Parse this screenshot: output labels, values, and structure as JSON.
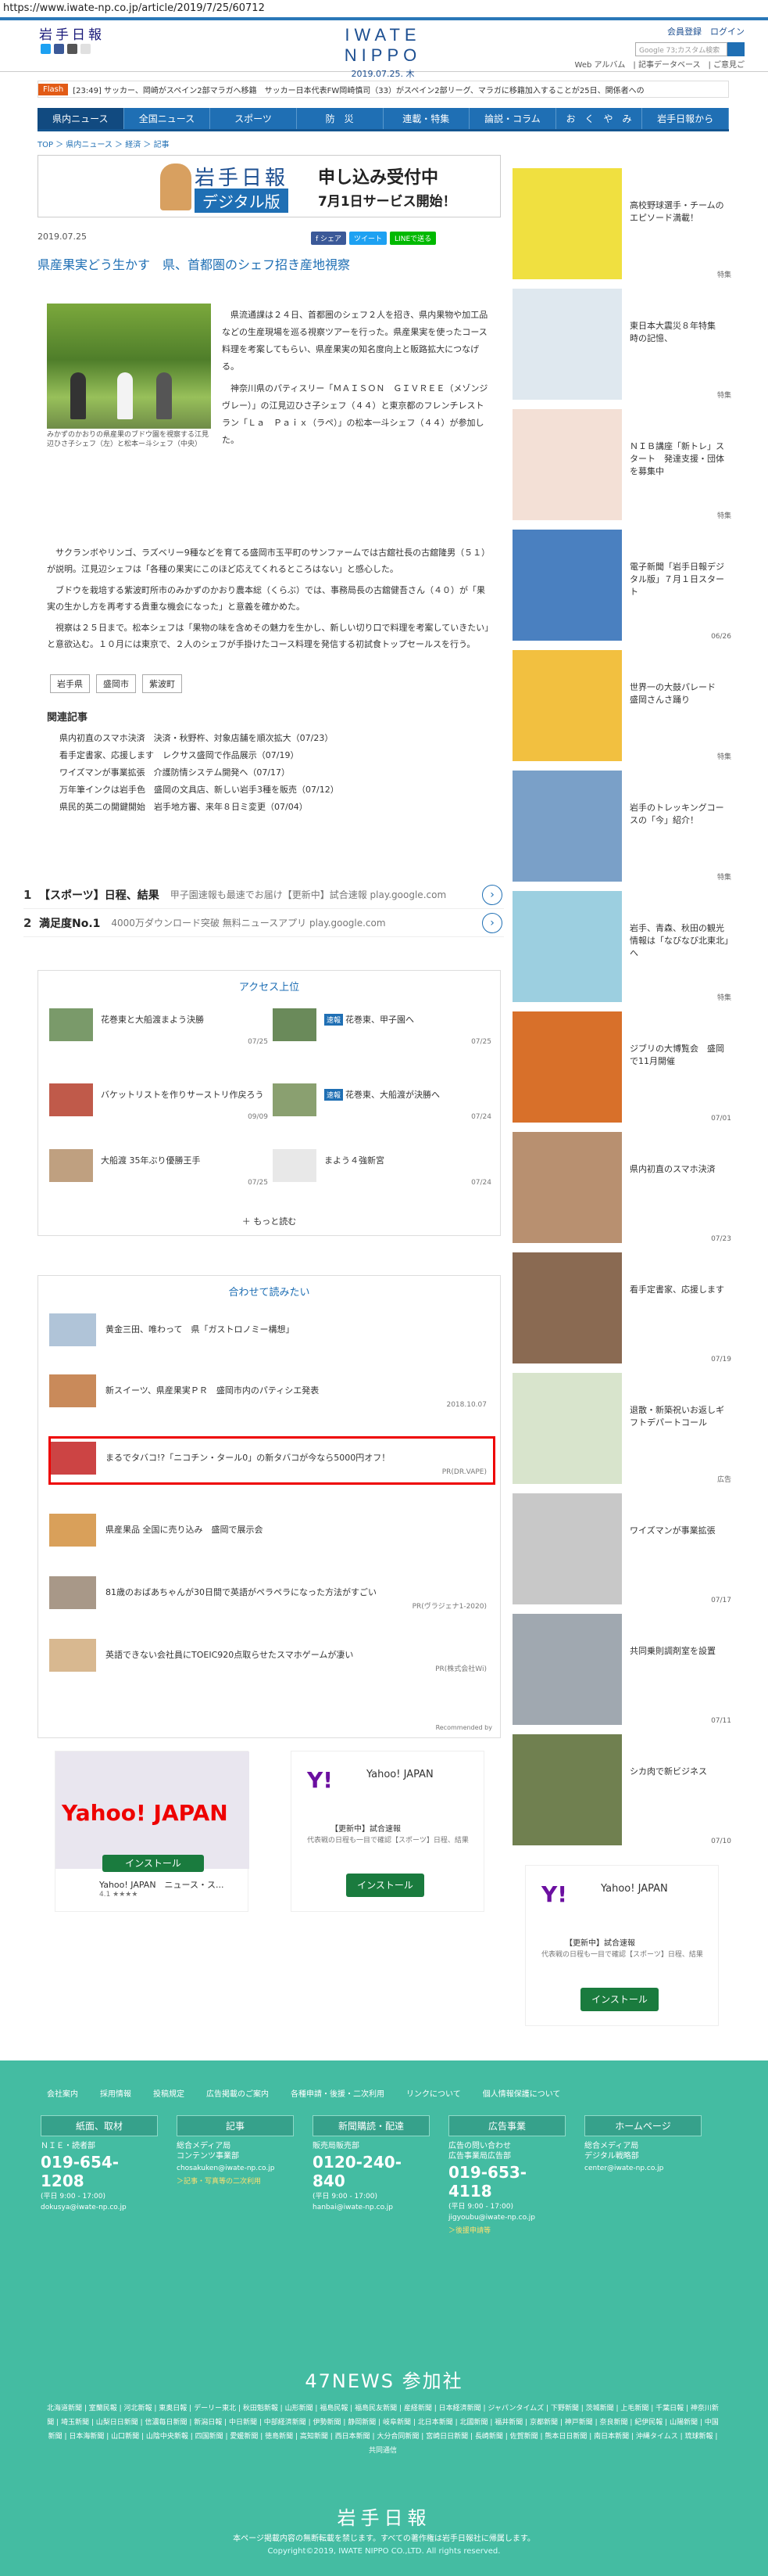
{
  "url": "https://www.iwate-np.co.jp/article/2019/7/25/60712",
  "header": {
    "logo_left": "岩手日報",
    "logo_center": "IWATE NIPPO",
    "date": "2019.07.25. 木",
    "account_links": "会員登録　ログイン",
    "search_placeholder": "Google 73;カスタム検索",
    "sublinks": "Web アルバム　| 記事データベース　| ご意見ご"
  },
  "flash": {
    "tag": "Flash",
    "text": "[23:49] サッカー、岡崎がスペイン2部マラガへ移籍　サッカー日本代表FW岡崎慎司（33）がスペイン2部リーグ、マラガに移籍加入することが25日、関係者への"
  },
  "nav": [
    "県内ニュース",
    "全国ニュース",
    "スポーツ",
    "防　災",
    "連載・特集",
    "論説・コラム",
    "お　く　や　み",
    "岩手日報から"
  ],
  "breadcrumb": "TOP ＞ 県内ニュース ＞ 経済 ＞ 記事",
  "banner": {
    "brand": "岩手日報",
    "digital": "デジタル版",
    "apply": "申し込み受付中",
    "start": "7月1日サービス開始！"
  },
  "article": {
    "date": "2019.07.25",
    "share": [
      "f シェア",
      "ツイート",
      "LINEで送る"
    ],
    "title": "県産果実どう生かす　県、首都圏のシェフ招き産地視察",
    "caption": "みかずのかおりの県産果のブドウ園を視察する江見辺ひさ子シェフ（左）と松本ー斗シェフ（中央）",
    "para1": "　県流通課は２４日、首都圏のシェフ２人を招き、県内果物や加工品などの生産現場を巡る視察ツアーを行った。県産果実を使ったコース料理を考案してもらい、県産果実の知名度向上と販路拡大につなげる。",
    "para2": "　神奈川県のパティスリー「ＭＡＩＳＯＮ　ＧＩＶＲＥＥ（メゾンジヴレー）」の江見辺ひさ子シェフ（４４）と東京都のフレンチレストラン「Ｌａ　Ｐａｉｘ（ラペ）」の松本一斗シェフ（４４）が参加した。",
    "para3": "　サクランボやリンゴ、ラズベリー9種などを育てる盛岡市玉平町のサンファームでは古舘社長の古舘隆男（５１）が説明。江見辺シェフは「各種の果実にこのほど応えてくれるところはない」と感心した。",
    "para4": "　ブドウを栽培する紫波町所市のみかずのかおり農本総（くらぶ）では、事務局長の古舘健吾さん（４０）が「果実の生かし方を再考する貴重な機会になった」と意義を確かめた。",
    "para5": "　視察は２５日まで。松本シェフは「果物の味を含めその魅力を生かし、新しい切り口で料理を考案していきたい」と意欲込む。１０月には東京で、２人のシェフが手掛けたコース料理を発信する初試食トップセールスを行う。",
    "tags": [
      "岩手県",
      "盛岡市",
      "紫波町"
    ],
    "related_title": "関連記事",
    "related": [
      "県内初直のスマホ決済　決済・秋野杵、対象店舗を順次拡大（07/23）",
      "看手定書家、応援します　レクサス盛岡で作品展示（07/19）",
      "ワイズマンが事業拡張　介護防情システム開発へ（07/17）",
      "万年筆インクは岩手色　盛岡の文具店、新しい岩手3種を販売（07/12）",
      "県民的英二の開鍵開始　岩手地方審、来年８日ミ変更（07/04）"
    ]
  },
  "ads1": [
    {
      "num": "1",
      "title": "【スポーツ】日程、結果",
      "desc": "甲子園速報も最速でお届け【更新中】試合速報 play.google.com"
    },
    {
      "num": "2",
      "title": "満足度No.1",
      "desc": "4000万ダウンロード突破 無料ニュースアプリ play.google.com"
    }
  ],
  "ranking": {
    "title": "アクセス上位",
    "items": [
      {
        "badge": "",
        "text": "花巻東と大船渡まよう決勝",
        "date": "07/25"
      },
      {
        "badge": "速報",
        "text": "花巻東、甲子園へ",
        "date": "07/25"
      },
      {
        "badge": "",
        "text": "バケットリストを作りサーストリ作戻ろう",
        "date": "09/09"
      },
      {
        "badge": "速報",
        "text": "花巻東、大船渡が決勝へ",
        "date": "07/24"
      },
      {
        "badge": "",
        "text": "大船渡 35年ぶり優勝王手",
        "date": "07/25"
      },
      {
        "badge": "",
        "text": "まよう４強新宮",
        "date": "07/24"
      }
    ],
    "more": "もっと読む"
  },
  "recommend": {
    "title": "合わせて読みたい",
    "items": [
      {
        "text": "黄金三田、唯わって　県「ガストロノミー構想」",
        "src": ""
      },
      {
        "text": "新スイーツ、県産果実ＰＲ　盛岡市内のパティシエ発表",
        "src": "2018.10.07"
      },
      {
        "text": "まるでタバコ!?「ニコチン・タール0」の新タバコが今なら5000円オフ！",
        "src": "PR(DR.VAPE)"
      },
      {
        "text": "県産果品 全国に売り込み　盛岡で展示会",
        "src": ""
      },
      {
        "text": "81歳のおばあちゃんが30日間で英語がペラペラになった方法がすごい",
        "src": "PR(ヴラジェナ1-2020)"
      },
      {
        "text": "英語できない会社員にTOEIC920点取らせたスマホゲームが凄い",
        "src": "PR(株式会社Wi)"
      }
    ],
    "powered": "Recommended by"
  },
  "google_ads": [
    {
      "brand": "Yahoo! JAPAN",
      "title": "Yahoo! JAPAN　ニュース・ス...",
      "btn": "インストール",
      "rating": "4.1 ★★★★"
    },
    {
      "brand": "Yahoo! JAPAN",
      "sub": "【更新中】試合速報",
      "desc": "代表戦の日程も一目で確認【スポーツ】日程、結果",
      "btn": "インストール"
    },
    {
      "brand": "Yahoo! JAPAN",
      "sub": "【更新中】試合速報",
      "desc": "代表戦の日程も一目で確認【スポーツ】日程、結果",
      "btn": "インストール"
    }
  ],
  "sidebar": [
    {
      "title": "高校野球選手・チームのエピソード満載！",
      "date": "特集"
    },
    {
      "title": "東日本大震災８年特集　時の記憶、",
      "date": "特集"
    },
    {
      "title": "ＮＩＢ講座「新トレ」スタート　発達支援・団体を募集中",
      "date": "特集"
    },
    {
      "title": "電子新聞「岩手日報デジタル版」７月１日スタート",
      "date": "06/26"
    },
    {
      "title": "世界一の大鼓パレード　盛岡さんさ踊り",
      "date": "特集"
    },
    {
      "title": "岩手のトレッキングコースの「今」紹介！",
      "date": "特集"
    },
    {
      "title": "岩手、青森、秋田の観光情報は「なびなび北東北」へ",
      "date": "特集"
    },
    {
      "title": "ジブリの大博覧会　盛岡で11月開催",
      "date": "07/01"
    },
    {
      "title": "県内初直のスマホ決済",
      "date": "07/23"
    },
    {
      "title": "看手定書家、応援します",
      "date": "07/19"
    },
    {
      "title": "退散・新築祝いお返しギフトデパートコール",
      "date": "広告"
    },
    {
      "title": "ワイズマンが事業拡張",
      "date": "07/17"
    },
    {
      "title": "共同乗則調剤室を設置",
      "date": "07/11"
    },
    {
      "title": "シカ肉で新ビジネス",
      "date": "07/10"
    }
  ],
  "footer": {
    "links": [
      "会社案内",
      "採用情報",
      "投稿規定",
      "広告掲載のご案内",
      "各種申請・後援・二次利用",
      "リンクについて",
      "個人情報保護について"
    ],
    "cols": [
      {
        "h": "紙面、取材",
        "s": "ＮＩＥ・読者部",
        "tel": "019-654-1208",
        "hr": "(平日 9:00 - 17:00)",
        "mail": "dokusya@iwate-np.co.jp",
        "note": ""
      },
      {
        "h": "記事",
        "s": "総合メディア局\nコンテンツ事業部",
        "tel": "",
        "hr": "",
        "mail": "chosakuken@iwate-np.co.jp",
        "note": "＞記事・写真等の二次利用"
      },
      {
        "h": "新聞購読・配達",
        "s": "販売局販売部",
        "tel": "0120-240-840",
        "hr": "(平日 9:00 - 17:00)",
        "mail": "hanbai@iwate-np.co.jp",
        "note": ""
      },
      {
        "h": "広告事業",
        "s": "広告の問い合わせ\n広告事業局広告部",
        "tel": "019-653-4118",
        "hr": "(平日 9:00 - 17:00)",
        "mail": "jigyoubu@iwate-np.co.jp",
        "note": "＞後援申請等"
      },
      {
        "h": "ホームページ",
        "s": "総合メディア局\nデジタル戦略部",
        "tel": "",
        "hr": "",
        "mail": "center@iwate-np.co.jp",
        "note": ""
      }
    ],
    "news47": "47NEWS 参加社",
    "papers": "北海道新聞 | 室蘭民報 | 河北新報 | 東奥日報 | デーリー東北 | 秋田魁新報 | 山形新聞 | 福島民報 | 福島民友新聞 | 産経新聞 | 日本経済新聞 | ジャパンタイムズ | 下野新聞 | 茨城新聞 | 上毛新聞 | 千葉日報 | 神奈川新聞 | 埼玉新聞 | 山梨日日新聞 | 信濃毎日新聞 | 新潟日報 | 中日新聞 | 中部経済新聞 | 伊勢新聞 | 静岡新聞 | 岐阜新聞 | 北日本新聞 | 北國新聞 | 福井新聞 | 京都新聞 | 神戸新聞 | 奈良新聞 | 紀伊民報 | 山陽新聞 | 中国新聞 | 日本海新聞 | 山口新聞 | 山陰中央新報 | 四国新聞 | 愛媛新聞 | 徳島新聞 | 高知新聞 | 西日本新聞 | 大分合同新聞 | 宮崎日日新聞 | 長崎新聞 | 佐賀新聞 | 熊本日日新聞 | 南日本新聞 | 沖縄タイムス | 琉球新報 | 共同通信",
    "logo": "岩手日報",
    "copy1": "本ページ掲載内容の無断転載を禁じます。すべての著作権は岩手日報社に帰属します。",
    "copy2": "Copyright©2019, IWATE NIPPO CO.,LTD. All rights reserved."
  }
}
